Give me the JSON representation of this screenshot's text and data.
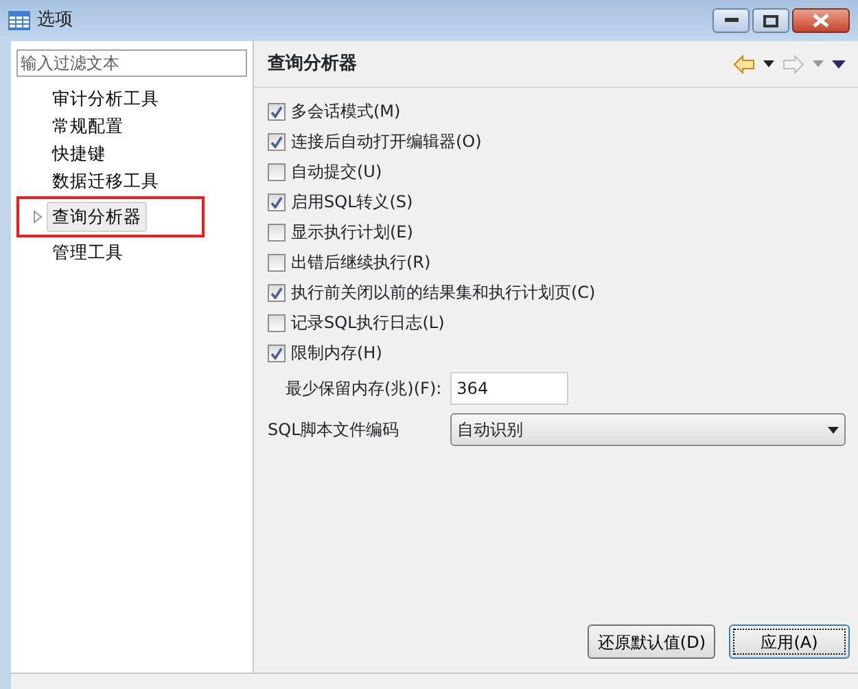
{
  "window": {
    "title": "选项"
  },
  "filter": {
    "placeholder": "输入过滤文本"
  },
  "tree": [
    {
      "label": "审计分析工具",
      "selected": false,
      "has_children": false,
      "highlighted": false
    },
    {
      "label": "常规配置",
      "selected": false,
      "has_children": false,
      "highlighted": false
    },
    {
      "label": "快捷键",
      "selected": false,
      "has_children": false,
      "highlighted": false
    },
    {
      "label": "数据迁移工具",
      "selected": false,
      "has_children": false,
      "highlighted": false
    },
    {
      "label": "查询分析器",
      "selected": true,
      "has_children": true,
      "highlighted": true
    },
    {
      "label": "管理工具",
      "selected": false,
      "has_children": false,
      "highlighted": false
    }
  ],
  "page": {
    "title": "查询分析器"
  },
  "options": [
    {
      "kind": "checkbox",
      "label": "多会话模式(M)",
      "checked": true
    },
    {
      "kind": "checkbox",
      "label": "连接后自动打开编辑器(O)",
      "checked": true
    },
    {
      "kind": "checkbox",
      "label": "自动提交(U)",
      "checked": false
    },
    {
      "kind": "checkbox",
      "label": "启用SQL转义(S)",
      "checked": true
    },
    {
      "kind": "checkbox",
      "label": "显示执行计划(E)",
      "checked": false
    },
    {
      "kind": "checkbox",
      "label": "出错后继续执行(R)",
      "checked": false
    },
    {
      "kind": "checkbox",
      "label": "执行前关闭以前的结果集和执行计划页(C)",
      "checked": true
    },
    {
      "kind": "checkbox",
      "label": "记录SQL执行日志(L)",
      "checked": false
    },
    {
      "kind": "checkbox",
      "label": "限制内存(H)",
      "checked": true
    },
    {
      "kind": "number",
      "label": "最少保留内存(兆)(F):",
      "value": "364"
    },
    {
      "kind": "select",
      "label": "SQL脚本文件编码",
      "value": "自动识别"
    }
  ],
  "buttons": [
    {
      "label": "还原默认值(D)",
      "default": false
    },
    {
      "label": "应用(A)",
      "default": true
    }
  ]
}
